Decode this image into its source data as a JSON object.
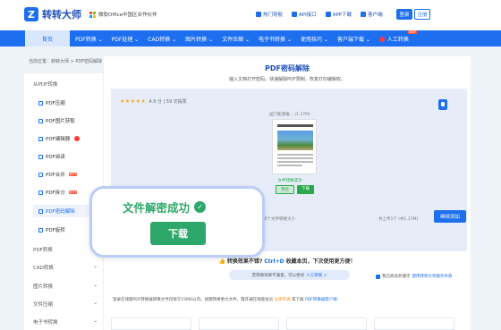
{
  "header": {
    "logo_mark": "Z",
    "logo_text": "转转大师",
    "partner": "微软Office中国区合作伙伴",
    "links": [
      "热门导航",
      "API接口",
      "APP下载",
      "客户端"
    ],
    "login": "登录",
    "register": "注册"
  },
  "nav": {
    "home": "首页",
    "items": [
      "PDF转换",
      "PDF处理",
      "CAD转换",
      "图片转换",
      "文件压缩",
      "电子书转换",
      "使用技巧",
      "客户端下载",
      "人工转换"
    ],
    "hot_badge": "HOT"
  },
  "breadcrumb": "当前位置：转转大师 > PDF密码解除",
  "sidebar": {
    "heading": "从PDF转换",
    "items": [
      "PDF压缩",
      "PDF图片获取",
      "PDF编辑器",
      "PDF阅读",
      "PDF合并",
      "PDF拆分",
      "PDF密码解除",
      "PDF旋转"
    ],
    "groups": [
      "PDF转换",
      "CAD转换",
      "图片转换",
      "文件压缩",
      "电子书转换"
    ]
  },
  "main": {
    "title": "PDF密码解除",
    "subtitle": "输入文档打开密码，快速解除PDF限制，恢复打印编辑权。",
    "rating": "4.9 分 | 59 次投票",
    "file_name": "国门能源报... (1.17M)",
    "status": "文件转换成功",
    "preview_btn": "预览",
    "download_btn": "下载",
    "hint": "单个文件转换大小",
    "count": "共上传1个 (共1.17M)",
    "add_btn": "继续添加",
    "agree": "我已阅读并遵守",
    "agree_link": "使用转转大师服务条款",
    "feedback_a": "转换效果不错?",
    "feedback_key": "Ctrl+D",
    "feedback_b": "收藏本页，下次使用更方便！",
    "ai_text": "若转换效果不满意，可以尝试",
    "ai_link": "人工转换 >",
    "notice_a": "登录在线版PDF转换器转换文件仅限于15MU以内。如需转换更大文件，需开通在线版会员",
    "notice_vip": "立即开通",
    "notice_b": "或下载",
    "notice_link": "PDF转换器客户端"
  },
  "toast": {
    "message": "文件解密成功",
    "button": "下载"
  },
  "colors": {
    "primary": "#1e6ff0",
    "success": "#2da86a",
    "hot": "#ff5a3c"
  }
}
